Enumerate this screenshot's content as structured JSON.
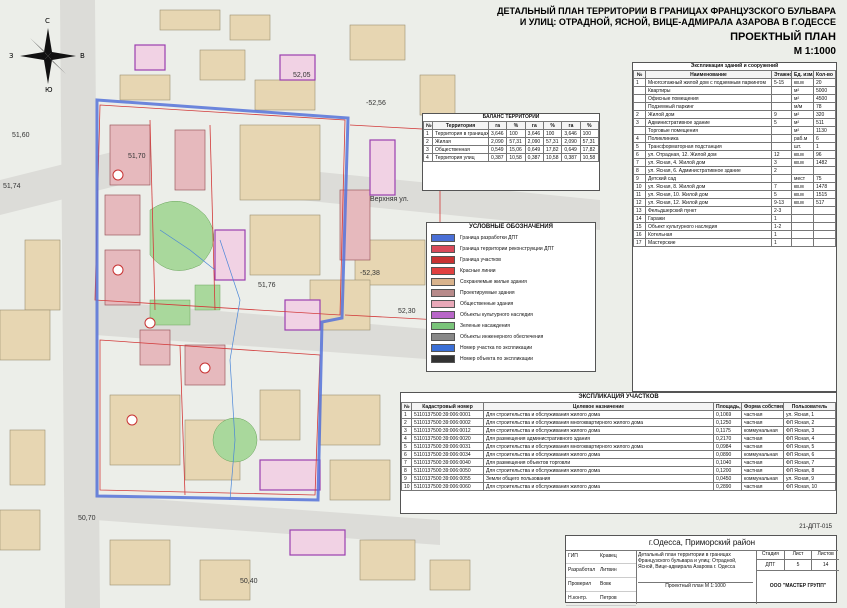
{
  "title": {
    "line1": "ДЕТАЛЬНЫЙ ПЛАН ТЕРРИТОРИИ В ГРАНИЦАХ ФРАНЦУЗСКОГО БУЛЬВАРА",
    "line2": "И УЛИЦ: ОТРАДНОЙ, ЯСНОЙ, ВИЦЕ-АДМИРАЛА АЗАРОВА В Г.ОДЕССЕ",
    "plan": "ПРОЕКТНЫЙ ПЛАН",
    "scale": "М 1:1000"
  },
  "compass": {
    "n": "С",
    "s": "Ю",
    "w": "З",
    "e": "В"
  },
  "map_labels": {
    "elev1": "52,05",
    "elev2": "-52,56",
    "elev3": "51,60",
    "elev4": "51,74",
    "elev5": "50,70",
    "elev6": "50,40",
    "elev7": "52,30",
    "elev8": "-52,38",
    "elev9": "51,76",
    "elev10": "51,70",
    "street": "Верхняя ул."
  },
  "balance": {
    "title": "БАЛАНС ТЕРРИТОРИИ",
    "headers": [
      "№",
      "Территория",
      "га",
      "%",
      "га",
      "%",
      "га",
      "%"
    ],
    "rows": [
      [
        "1",
        "Территория в границах разработки ДПТ",
        "3,646",
        "100",
        "3,646",
        "100",
        "3,646",
        "100"
      ],
      [
        "2",
        "Жилая",
        "2,090",
        "57,31",
        "2,090",
        "57,31",
        "2,090",
        "57,31"
      ],
      [
        "3",
        "Общественная",
        "0,549",
        "15,06",
        "0,649",
        "17,82",
        "0,649",
        "17,82"
      ],
      [
        "4",
        "Территория улиц",
        "0,387",
        "10,58",
        "0,387",
        "10,58",
        "0,387",
        "10,58"
      ]
    ]
  },
  "legend": {
    "title": "УСЛОВНЫЕ ОБОЗНАЧЕНИЯ",
    "items": [
      {
        "label": "Граница разработки ДПТ",
        "color": "#4a6fd6"
      },
      {
        "label": "Граница территории реконструкции ДПТ",
        "color": "#d94a5a"
      },
      {
        "label": "Граница участков",
        "color": "#c83232"
      },
      {
        "label": "Красные линии",
        "color": "#e04040"
      },
      {
        "label": "Сохраняемые жилые здания",
        "color": "#d9b38c"
      },
      {
        "label": "Проектируемые здания",
        "color": "#b78a8a"
      },
      {
        "label": "Общественные здания",
        "color": "#e8a8b8"
      },
      {
        "label": "Объекты культурного наследия",
        "color": "#b866c8"
      },
      {
        "label": "Зеленые насаждения",
        "color": "#7ac47a"
      },
      {
        "label": "Объекты инженерного обеспечения",
        "color": "#888888"
      },
      {
        "label": "Номер участка по экспликации",
        "color": "#3a6fd6"
      },
      {
        "label": "Номер объекта по экспликации",
        "color": "#333333"
      }
    ]
  },
  "expl_buildings": {
    "title": "Экспликация зданий и сооружений",
    "headers": [
      "№",
      "Наименование",
      "Этажность",
      "Ед. изм.",
      "Кол-во"
    ],
    "rows": [
      [
        "1",
        "Многоэтажный жилой дом с подземным паркингом",
        "5-15",
        "кв.м",
        "20"
      ],
      [
        "",
        "Квартиры",
        "",
        "м²",
        "5000"
      ],
      [
        "",
        "Офисные помещения",
        "",
        "м²",
        "4500"
      ],
      [
        "",
        "Подземный паркинг",
        "",
        "м/м",
        "78"
      ],
      [
        "2",
        "Жилой дом",
        "9",
        "м²",
        "320"
      ],
      [
        "3",
        "Административное здание",
        "5",
        "м²",
        "511"
      ],
      [
        "",
        "Торговые помещения",
        "",
        "м²",
        "1130"
      ],
      [
        "4",
        "Поликлиника",
        "",
        "раб.м",
        "6"
      ],
      [
        "5",
        "Трансформаторная подстанция",
        "",
        "шт.",
        "1"
      ],
      [
        "6",
        "ул. Отрадная, 12. Жилой дом",
        "12",
        "кв.м",
        "96"
      ],
      [
        "7",
        "ул. Ясная, 4. Жилой дом",
        "3",
        "кв.м",
        "1482"
      ],
      [
        "8",
        "ул. Ясная, 6. Административное здание",
        "2",
        "",
        ""
      ],
      [
        "9",
        "Детский сад",
        "",
        "мест",
        "75"
      ],
      [
        "10",
        "ул. Ясная, 8. Жилой дом",
        "7",
        "кв.м",
        "1478"
      ],
      [
        "11",
        "ул. Ясная, 10. Жилой дом",
        "5",
        "кв.м",
        "1515"
      ],
      [
        "12",
        "ул. Ясная, 12. Жилой дом",
        "9-13",
        "кв.м",
        "517"
      ],
      [
        "13",
        "Фельдшерский пункт",
        "2-3",
        "",
        ""
      ],
      [
        "14",
        "Гаражи",
        "1",
        "",
        ""
      ],
      [
        "15",
        "Объект культурного наследия",
        "1-2",
        "",
        ""
      ],
      [
        "16",
        "Котельная",
        "1",
        "",
        ""
      ],
      [
        "17",
        "Мастерские",
        "1",
        "",
        ""
      ]
    ]
  },
  "expl_plots": {
    "title": "ЭКСПЛИКАЦИЯ УЧАСТКОВ",
    "headers": [
      "№",
      "Кадастровый номер",
      "Целевое назначение",
      "Площадь, га",
      "Форма собственности",
      "Пользователь"
    ],
    "rows": [
      [
        "1",
        "5110137500:39:006:0001",
        "Для строительства и обслуживания жилого дома",
        "0,1069",
        "частная",
        "ул. Ясная, 1"
      ],
      [
        "2",
        "5110137500:39:006:0002",
        "Для строительства и обслуживания многоквартирного жилого дома",
        "0,1250",
        "частная",
        "ФЛ Ясная, 2"
      ],
      [
        "3",
        "5110137500:39:006:0012",
        "Для строительства и обслуживания жилого дома",
        "0,1175",
        "коммунальная",
        "ФЛ Ясная, 3"
      ],
      [
        "4",
        "5110137500:39:006:0020",
        "Для размещения административного здания",
        "0,2170",
        "частная",
        "ФЛ Ясная, 4"
      ],
      [
        "5",
        "5110137500:39:006:0031",
        "Для строительства и обслуживания многоквартирного жилого дома",
        "0,0984",
        "частная",
        "ФЛ Ясная, 5"
      ],
      [
        "6",
        "5110137500:39:006:0034",
        "Для строительства и обслуживания жилого дома",
        "0,0890",
        "коммунальная",
        "ФЛ Ясная, 6"
      ],
      [
        "7",
        "5110137500:39:006:0040",
        "Для размещения объектов торговли",
        "0,1040",
        "частная",
        "ФЛ Ясная, 7"
      ],
      [
        "8",
        "5110137500:39:006:0050",
        "Для строительства и обслуживания жилого дома",
        "0,1200",
        "частная",
        "ФЛ Ясная, 8"
      ],
      [
        "9",
        "5110137500:39:006:0055",
        "Земли общего пользования",
        "0,0450",
        "коммунальная",
        "ул. Ясная, 9"
      ],
      [
        "10",
        "5110137500:39:006:0060",
        "Для строительства и обслуживания жилого дома",
        "0,2890",
        "частная",
        "ФЛ Ясная, 10"
      ]
    ]
  },
  "stamp": {
    "code": "21-ДПТ-015",
    "location": "г.Одесса, Приморский район",
    "desc": "Детальный план территории в границах Французского бульвара и улиц: Отрадной, Ясной, Вице-адмирала Азарова г. Одесса",
    "drawing": "Проектный план М 1:1000",
    "stage_h": "Стадия",
    "sheet_h": "Лист",
    "sheets_h": "Листов",
    "stage": "ДПТ",
    "sheet": "5",
    "sheets": "14",
    "org": "ООО \"МАСТЕР ГРУПП\"",
    "roles": [
      "ГИП",
      "Разработал",
      "Проверил",
      "Н.контр."
    ],
    "names": [
      "Кравец",
      "Литвин",
      "Вовк",
      "Петров"
    ]
  }
}
